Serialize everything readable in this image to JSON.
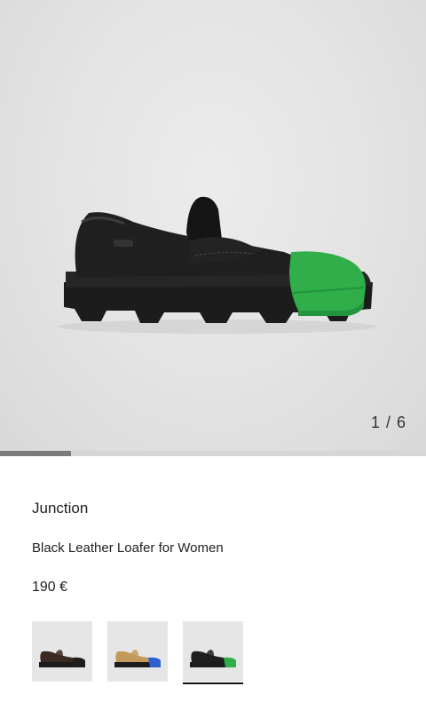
{
  "gallery": {
    "counter": "1 / 6",
    "image_alt": "Black loafer with green toe cap",
    "progress_fraction": 0.1667
  },
  "product": {
    "name": "Junction",
    "subtitle": "Black Leather Loafer for Women",
    "price": "190 €"
  },
  "variants": [
    {
      "label": "Brown loafer with black toe",
      "upper": "#3a2a22",
      "toe": "#1e1e1e",
      "selected": false
    },
    {
      "label": "Tan loafer with blue toe",
      "upper": "#c49a5a",
      "toe": "#2f5fd0",
      "selected": false
    },
    {
      "label": "Black loafer with green toe",
      "upper": "#1f1f1f",
      "toe": "#2fae49",
      "selected": true
    }
  ],
  "colors": {
    "hero_bg": "#e5e5e5",
    "accent_green": "#2fae49"
  }
}
